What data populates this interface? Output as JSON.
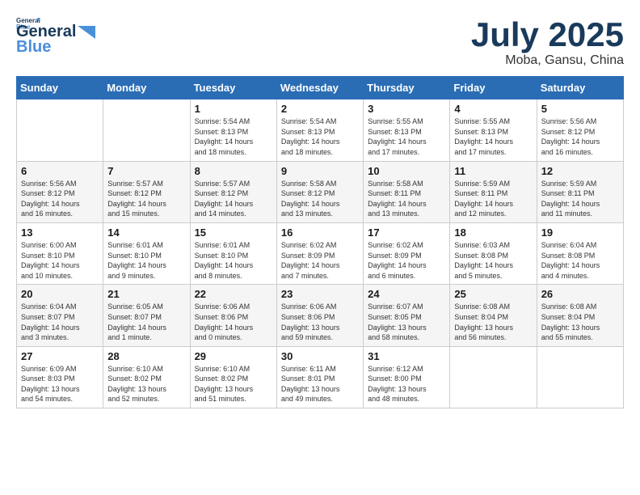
{
  "header": {
    "logo_line1": "General",
    "logo_line2": "Blue",
    "month": "July 2025",
    "location": "Moba, Gansu, China"
  },
  "weekdays": [
    "Sunday",
    "Monday",
    "Tuesday",
    "Wednesday",
    "Thursday",
    "Friday",
    "Saturday"
  ],
  "weeks": [
    [
      {
        "day": "",
        "info": ""
      },
      {
        "day": "",
        "info": ""
      },
      {
        "day": "1",
        "info": "Sunrise: 5:54 AM\nSunset: 8:13 PM\nDaylight: 14 hours\nand 18 minutes."
      },
      {
        "day": "2",
        "info": "Sunrise: 5:54 AM\nSunset: 8:13 PM\nDaylight: 14 hours\nand 18 minutes."
      },
      {
        "day": "3",
        "info": "Sunrise: 5:55 AM\nSunset: 8:13 PM\nDaylight: 14 hours\nand 17 minutes."
      },
      {
        "day": "4",
        "info": "Sunrise: 5:55 AM\nSunset: 8:13 PM\nDaylight: 14 hours\nand 17 minutes."
      },
      {
        "day": "5",
        "info": "Sunrise: 5:56 AM\nSunset: 8:12 PM\nDaylight: 14 hours\nand 16 minutes."
      }
    ],
    [
      {
        "day": "6",
        "info": "Sunrise: 5:56 AM\nSunset: 8:12 PM\nDaylight: 14 hours\nand 16 minutes."
      },
      {
        "day": "7",
        "info": "Sunrise: 5:57 AM\nSunset: 8:12 PM\nDaylight: 14 hours\nand 15 minutes."
      },
      {
        "day": "8",
        "info": "Sunrise: 5:57 AM\nSunset: 8:12 PM\nDaylight: 14 hours\nand 14 minutes."
      },
      {
        "day": "9",
        "info": "Sunrise: 5:58 AM\nSunset: 8:12 PM\nDaylight: 14 hours\nand 13 minutes."
      },
      {
        "day": "10",
        "info": "Sunrise: 5:58 AM\nSunset: 8:11 PM\nDaylight: 14 hours\nand 13 minutes."
      },
      {
        "day": "11",
        "info": "Sunrise: 5:59 AM\nSunset: 8:11 PM\nDaylight: 14 hours\nand 12 minutes."
      },
      {
        "day": "12",
        "info": "Sunrise: 5:59 AM\nSunset: 8:11 PM\nDaylight: 14 hours\nand 11 minutes."
      }
    ],
    [
      {
        "day": "13",
        "info": "Sunrise: 6:00 AM\nSunset: 8:10 PM\nDaylight: 14 hours\nand 10 minutes."
      },
      {
        "day": "14",
        "info": "Sunrise: 6:01 AM\nSunset: 8:10 PM\nDaylight: 14 hours\nand 9 minutes."
      },
      {
        "day": "15",
        "info": "Sunrise: 6:01 AM\nSunset: 8:10 PM\nDaylight: 14 hours\nand 8 minutes."
      },
      {
        "day": "16",
        "info": "Sunrise: 6:02 AM\nSunset: 8:09 PM\nDaylight: 14 hours\nand 7 minutes."
      },
      {
        "day": "17",
        "info": "Sunrise: 6:02 AM\nSunset: 8:09 PM\nDaylight: 14 hours\nand 6 minutes."
      },
      {
        "day": "18",
        "info": "Sunrise: 6:03 AM\nSunset: 8:08 PM\nDaylight: 14 hours\nand 5 minutes."
      },
      {
        "day": "19",
        "info": "Sunrise: 6:04 AM\nSunset: 8:08 PM\nDaylight: 14 hours\nand 4 minutes."
      }
    ],
    [
      {
        "day": "20",
        "info": "Sunrise: 6:04 AM\nSunset: 8:07 PM\nDaylight: 14 hours\nand 3 minutes."
      },
      {
        "day": "21",
        "info": "Sunrise: 6:05 AM\nSunset: 8:07 PM\nDaylight: 14 hours\nand 1 minute."
      },
      {
        "day": "22",
        "info": "Sunrise: 6:06 AM\nSunset: 8:06 PM\nDaylight: 14 hours\nand 0 minutes."
      },
      {
        "day": "23",
        "info": "Sunrise: 6:06 AM\nSunset: 8:06 PM\nDaylight: 13 hours\nand 59 minutes."
      },
      {
        "day": "24",
        "info": "Sunrise: 6:07 AM\nSunset: 8:05 PM\nDaylight: 13 hours\nand 58 minutes."
      },
      {
        "day": "25",
        "info": "Sunrise: 6:08 AM\nSunset: 8:04 PM\nDaylight: 13 hours\nand 56 minutes."
      },
      {
        "day": "26",
        "info": "Sunrise: 6:08 AM\nSunset: 8:04 PM\nDaylight: 13 hours\nand 55 minutes."
      }
    ],
    [
      {
        "day": "27",
        "info": "Sunrise: 6:09 AM\nSunset: 8:03 PM\nDaylight: 13 hours\nand 54 minutes."
      },
      {
        "day": "28",
        "info": "Sunrise: 6:10 AM\nSunset: 8:02 PM\nDaylight: 13 hours\nand 52 minutes."
      },
      {
        "day": "29",
        "info": "Sunrise: 6:10 AM\nSunset: 8:02 PM\nDaylight: 13 hours\nand 51 minutes."
      },
      {
        "day": "30",
        "info": "Sunrise: 6:11 AM\nSunset: 8:01 PM\nDaylight: 13 hours\nand 49 minutes."
      },
      {
        "day": "31",
        "info": "Sunrise: 6:12 AM\nSunset: 8:00 PM\nDaylight: 13 hours\nand 48 minutes."
      },
      {
        "day": "",
        "info": ""
      },
      {
        "day": "",
        "info": ""
      }
    ]
  ]
}
